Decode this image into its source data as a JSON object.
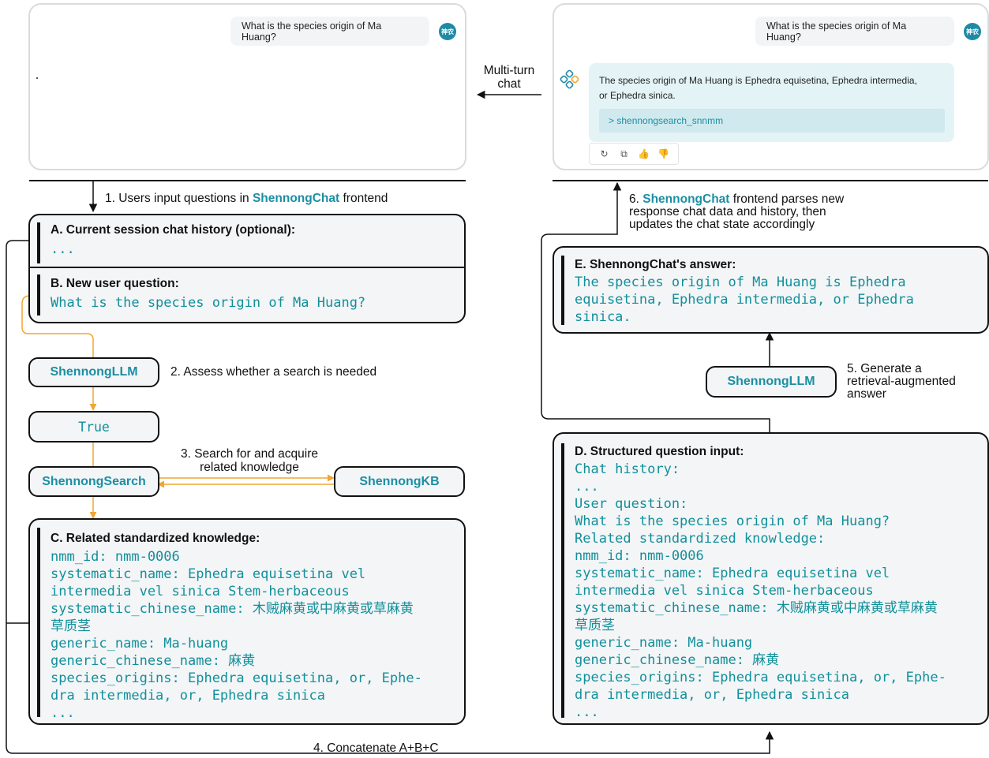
{
  "left_chat": {
    "user_message": "What is the species origin of Ma Huang?",
    "avatar_text": "神农"
  },
  "right_chat": {
    "user_message": "What is the species origin of Ma Huang?",
    "avatar_text": "神农",
    "answer_line1": "The species origin of Ma Huang is Ephedra equisetina, Ephedra intermedia,",
    "answer_line2": "or Ephedra sinica.",
    "search_chip": "> shennongsearch_snnmm",
    "toolbar": [
      "↻",
      "⧉",
      "👍",
      "👎"
    ]
  },
  "multi_turn": {
    "line1": "Multi-turn",
    "line2": "chat"
  },
  "steps": {
    "step1_prefix": "1. Users input questions in ",
    "step1_brand": "ShennongChat",
    "step1_suffix": " frontend",
    "step2": "2. Assess whether a search is needed",
    "step3_line1": "3. Search for and acquire",
    "step3_line2": "related knowledge",
    "step4": "4. Concatenate A+B+C",
    "step5_line1": "5. Generate a",
    "step5_line2": "retrieval-augmented",
    "step5_line3": "answer",
    "step6_prefix": "6. ",
    "step6_brand": "ShennongChat",
    "step6_line1_suffix": " frontend parses new",
    "step6_line2": "response chat data and history, then",
    "step6_line3": "updates the chat state accordingly"
  },
  "box_a": {
    "title": "A. Current session chat history (optional):",
    "body": "..."
  },
  "box_b": {
    "title": "B. New user question:",
    "body": "What is the species origin of Ma Huang?"
  },
  "nodes": {
    "llm_left": "ShennongLLM",
    "true_node": "True",
    "search": "ShennongSearch",
    "kb": "ShennongKB",
    "llm_right": "ShennongLLM"
  },
  "box_c": {
    "title": "C. Related standardized knowledge:",
    "lines": [
      "nmm_id: nmm-0006",
      "systematic_name: Ephedra equisetina vel",
      "intermedia vel sinica Stem-herbaceous",
      "systematic_chinese_name: 木贼麻黄或中麻黄或草麻黄",
      "草质茎",
      "generic_name: Ma-huang",
      "generic_chinese_name: 麻黄",
      "species_origins: Ephedra equisetina, or, Ephe-",
      "dra intermedia, or, Ephedra sinica",
      "..."
    ]
  },
  "box_d": {
    "title": "D. Structured question input:",
    "lines": [
      "Chat history:",
      "...",
      "User question:",
      "What is the species origin of Ma Huang?",
      "Related standardized knowledge:",
      "nmm_id: nmm-0006",
      "systematic_name: Ephedra equisetina vel",
      "intermedia vel sinica Stem-herbaceous",
      "systematic_chinese_name: 木贼麻黄或中麻黄或草麻黄",
      "草质茎",
      "generic_name: Ma-huang",
      "generic_chinese_name: 麻黄",
      "species_origins: Ephedra equisetina, or, Ephe-",
      "dra intermedia, or, Ephedra sinica",
      "..."
    ]
  },
  "box_e": {
    "title": "E. ShennongChat's answer:",
    "lines": [
      "The species origin of Ma Huang is Ephedra",
      "equisetina, Ephedra intermedia, or Ephedra",
      "sinica."
    ]
  }
}
